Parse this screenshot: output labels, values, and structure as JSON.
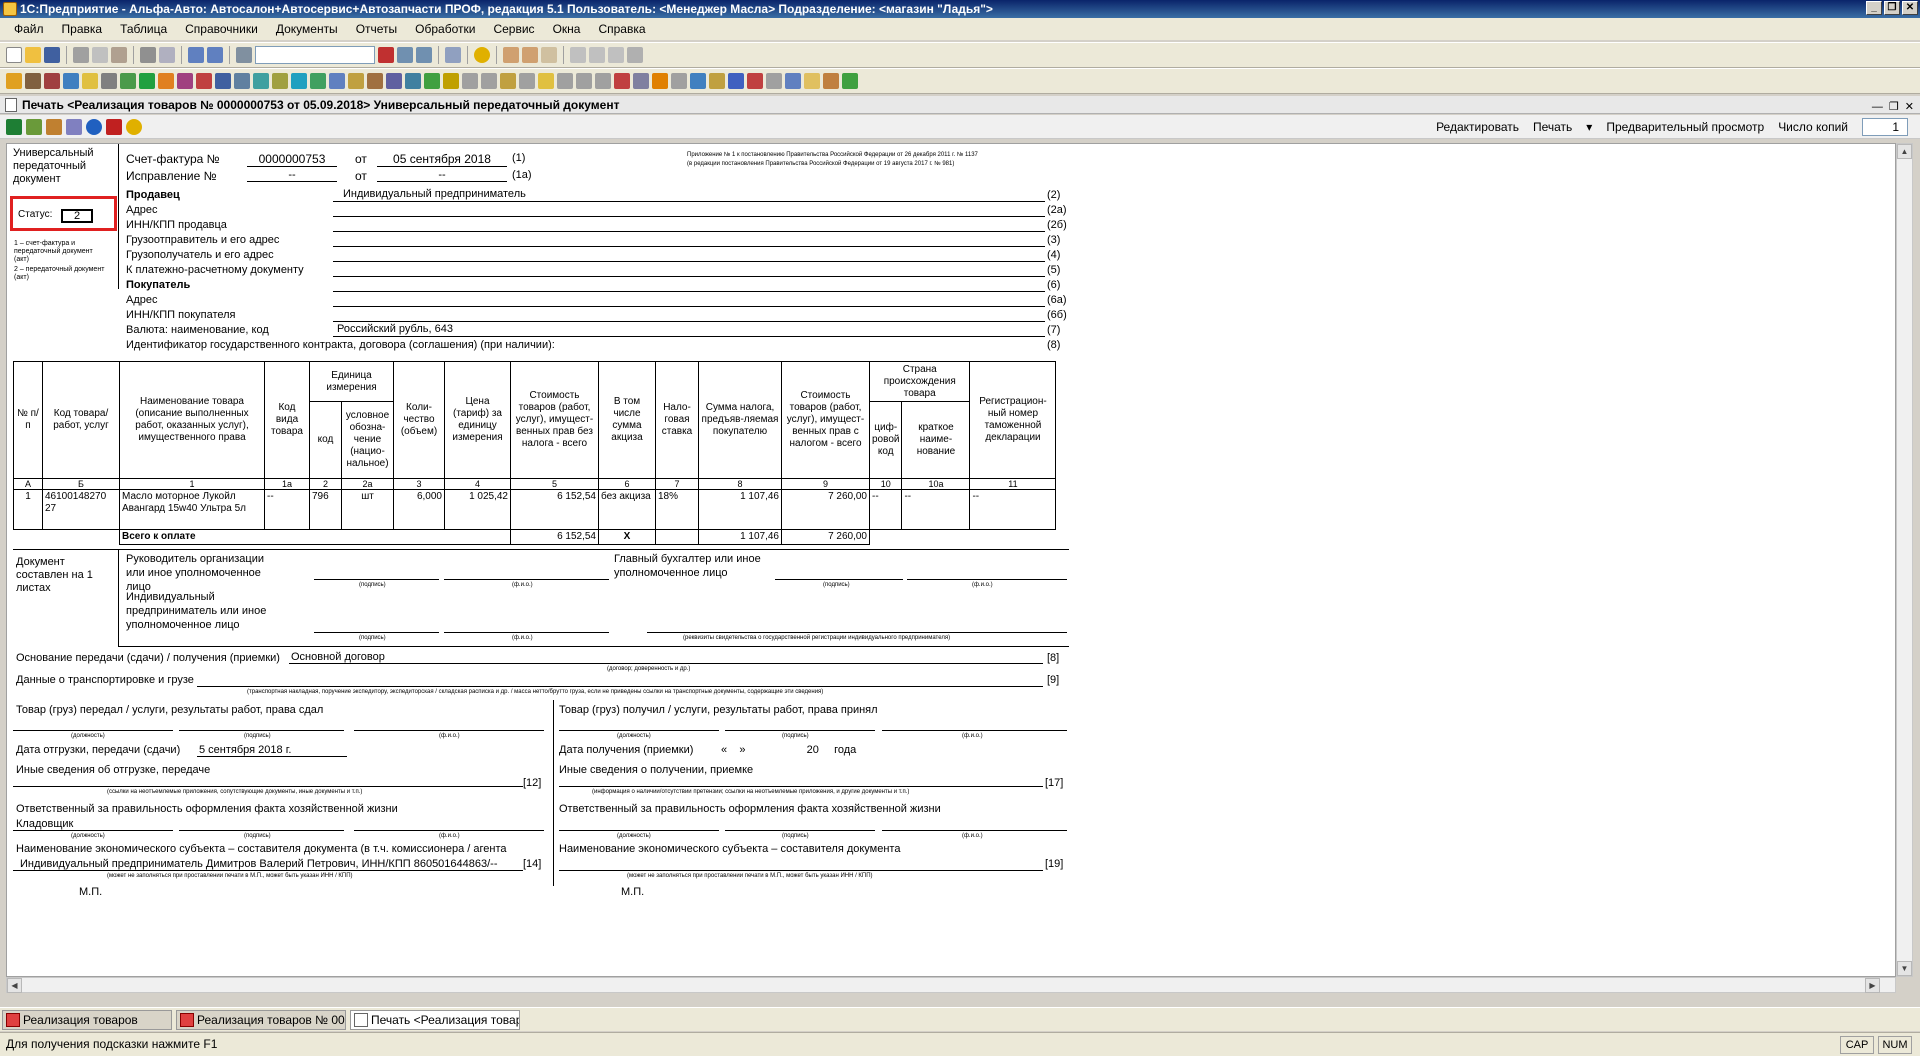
{
  "window": {
    "title": "1С:Предприятие - Альфа-Авто: Автосалон+Автосервис+Автозапчасти ПРОФ, редакция 5.1    Пользователь: <Менеджер Масла>    Подразделение: <магазин \"Ладья\">"
  },
  "menu": [
    "Файл",
    "Правка",
    "Таблица",
    "Справочники",
    "Документы",
    "Отчеты",
    "Обработки",
    "Сервис",
    "Окна",
    "Справка"
  ],
  "doc_window": {
    "title": "Печать <Реализация товаров № 0000000753 от 05.09.2018> Универсальный передаточный документ"
  },
  "actions": {
    "edit": "Редактировать",
    "print": "Печать",
    "preview": "Предварительный просмотр",
    "copies_label": "Число копий",
    "copies_value": "1"
  },
  "upd": {
    "left_title": "Универсальный передаточный документ",
    "status_label": "Статус:",
    "status_value": "2",
    "status_note1": "1 – счет-фактура и передаточный документ (акт)",
    "status_note2": "2 – передаточный документ (акт)",
    "invoice_label": "Счет-фактура №",
    "invoice_number": "0000000753",
    "from": "от",
    "invoice_date": "05 сентября 2018",
    "code1": "(1)",
    "corr_label": "Исправление №",
    "corr_number": "--",
    "corr_date": "--",
    "code1a": "(1а)",
    "appendix1": "Приложение № 1 к постановлению Правительства Российской Федерации от 26 декабря 2011 г. № 1137",
    "appendix2": "(в редакции постановления Правительства Российской Федерации от 19 августа 2017 г. № 981)",
    "seller_label": "Продавец",
    "seller_value": "Индивидуальный предприниматель",
    "c2": "(2)",
    "addr_label": "Адрес",
    "c2a": "(2а)",
    "inn_seller_label": "ИНН/КПП продавца",
    "c2b": "(2б)",
    "shipper_label": "Грузоотправитель и его адрес",
    "c3": "(3)",
    "consignee_label": "Грузополучатель и его адрес",
    "c4": "(4)",
    "payment_label": "К платежно-расчетному документу",
    "c5": "(5)",
    "buyer_label": "Покупатель",
    "c6": "(6)",
    "buyer_addr_label": "Адрес",
    "c6a": "(6а)",
    "inn_buyer_label": "ИНН/КПП покупателя",
    "c6b": "(6б)",
    "currency_label": "Валюта: наименование, код",
    "currency_value": "Российский рубль, 643",
    "c7": "(7)",
    "contract_label": "Идентификатор государственного контракта, договора (соглашения) (при наличии):",
    "c8": "(8)"
  },
  "table": {
    "headers": {
      "num": "№ п/п",
      "code": "Код товара/ работ, услуг",
      "name": "Наименование товара (описание выполненных работ, оказанных услуг), имущественного права",
      "kind": "Код вида товара",
      "unit": "Единица измерения",
      "unit_code": "код",
      "unit_name": "условное обозна-чение (нацио-нальное)",
      "qty": "Коли-чество (объем)",
      "price": "Цена (тариф) за единицу измерения",
      "cost_wo": "Стоимость товаров (работ, услуг), имущест-венных прав без налога - всего",
      "excise": "В том числе сумма акциза",
      "rate": "Нало-говая ставка",
      "tax": "Сумма налога, предъяв-ляемая покупателю",
      "cost_w": "Стоимость товаров (работ, услуг), имущест-венных прав с налогом - всего",
      "country": "Страна происхождения товара",
      "country_code": "циф-ровой код",
      "country_name": "краткое наиме-нование",
      "customs": "Регистрацион-ный номер таможенной декларации"
    },
    "col_numbers": [
      "А",
      "Б",
      "1",
      "1а",
      "2",
      "2а",
      "3",
      "4",
      "5",
      "6",
      "7",
      "8",
      "9",
      "10",
      "10а",
      "11"
    ],
    "rows": [
      {
        "num": "1",
        "code": "46100148270 27",
        "name": "Масло моторное Лукойл Авангард 15w40 Ультра 5л",
        "kind": "--",
        "unit_code": "796",
        "unit_name": "шт",
        "qty": "6,000",
        "price": "1 025,42",
        "cost_wo": "6 152,54",
        "excise": "без акциза",
        "rate": "18%",
        "tax": "1 107,46",
        "cost_w": "7 260,00",
        "country_code": "--",
        "country_name": "--",
        "customs": "--"
      }
    ],
    "total": {
      "label": "Всего к оплате",
      "cost_wo": "6 152,54",
      "excise": "X",
      "tax": "1 107,46",
      "cost_w": "7 260,00"
    }
  },
  "signatures": {
    "doc_sheets": "Документ составлен на 1 листах",
    "head_label": "Руководитель организации или иное уполномоченное лицо",
    "chief_acc_label": "Главный бухгалтер или иное уполномоченное лицо",
    "ip_label": "Индивидуальный предприниматель или иное уполномоченное лицо",
    "sign": "(подпись)",
    "fio": "(ф.и.о.)",
    "position": "(должность)",
    "ip_req": "(реквизиты свидетельства о государственной регистрации индивидуального предпринимателя)"
  },
  "transfer": {
    "basis_label": "Основание передачи (сдачи) / получения (приемки)",
    "basis_value": "Основной договор",
    "c8b": "[8]",
    "basis_hint": "(договор; доверенность и др.)",
    "transport_label": "Данные о транспортировке и грузе",
    "c9": "[9]",
    "transport_hint": "(транспортная накладная, поручение экспедитору, экспедиторская / складская расписка и др. / масса нетто/брутто груза, если не приведены ссылки на транспортные документы, содержащие эти сведения)",
    "sent_label": "Товар (груз) передал / услуги, результаты работ, права сдал",
    "recv_label": "Товар (груз) получил / услуги, результаты работ, права принял",
    "ship_date_label": "Дата отгрузки, передачи (сдачи)",
    "ship_date_value": "5 сентября 2018 г.",
    "recv_date_label": "Дата получения (приемки)",
    "recv_date_value": "«    »                    20     года",
    "other_ship_label": "Иные сведения об отгрузке, передаче",
    "c12": "[12]",
    "other_ship_hint": "(ссылки на неотъемлемые приложения, сопутствующие документы, иные документы и т.п.)",
    "other_recv_label": "Иные сведения о получении, приемке",
    "c17": "[17]",
    "other_recv_hint": "(информация о наличии/отсутствии претензии; ссылки на неотъемлемые приложения, и другие документы и т.п.)",
    "resp_label": "Ответственный за правильность оформления факта хозяйственной жизни",
    "resp_value": "Кладовщик",
    "entity_label_left": "Наименование экономического субъекта – составителя документа (в т.ч. комиссионера / агента",
    "entity_value_left": "Индивидуальный предприниматель Димитров Валерий Петрович, ИНН/КПП 860501644863/--",
    "c14": "[14]",
    "entity_label_right": "Наименование экономического субъекта – составителя документа",
    "c19": "[19]",
    "entity_hint": "(может не заполняться при проставлении печати в М.П., может быть указан ИНН / КПП)",
    "mp": "М.П."
  },
  "tasks": [
    "Реализация товаров",
    "Реализация товаров № 000...",
    "Печать <Реализация товар..."
  ],
  "status": {
    "hint": "Для получения подсказки нажмите F1",
    "cap": "CAP",
    "num": "NUM"
  }
}
